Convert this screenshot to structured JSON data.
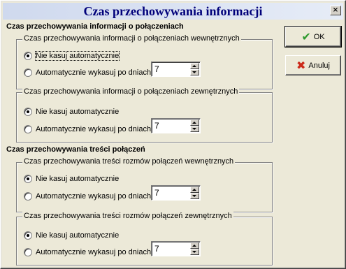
{
  "window": {
    "title": "Czas przechowywania informacji",
    "close_label": "×"
  },
  "buttons": {
    "ok_label": "OK",
    "cancel_label": "Anuluj"
  },
  "sections": [
    {
      "title": "Czas przechowywania informacji o połączeniach",
      "groups": [
        {
          "legend": "Czas przechowywania informacji o połączeniach wewnętrznych",
          "option1": "Nie kasuj automatycznie",
          "option2": "Automatycznie wykasuj po dniach:",
          "days": "7",
          "selected": 1
        },
        {
          "legend": "Czas przechowywania informacji o połączeniach zewnętrznych",
          "option1": "Nie kasuj automatycznie",
          "option2": "Automatycznie wykasuj po dniach:",
          "days": "7",
          "selected": 1
        }
      ]
    },
    {
      "title": "Czas przechowywania treści połączeń",
      "groups": [
        {
          "legend": "Czas przechowywania treści rozmów połączeń wewnętrznych",
          "option1": "Nie kasuj automatycznie",
          "option2": "Automatycznie wykasuj po dniach:",
          "days": "7",
          "selected": 1
        },
        {
          "legend": "Czas przechowywania treści rozmów połączeń zewnętrznych",
          "option1": "Nie kasuj automatycznie",
          "option2": "Automatycznie wykasuj po dniach:",
          "days": "7",
          "selected": 1
        }
      ]
    }
  ]
}
